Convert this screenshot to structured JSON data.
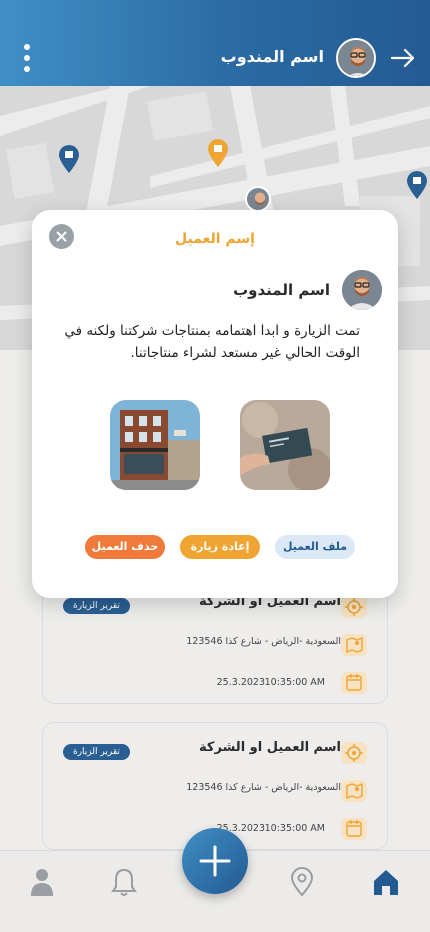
{
  "header": {
    "rep_name": "اسم المندوب",
    "menu_icon": "kebab-menu-icon",
    "back_icon": "arrow-right-icon"
  },
  "modal": {
    "title": "إسم العميل",
    "rep_name": "اسم المندوب",
    "note": "تمت الزيارة و ابدا اهتمامه بمنتاجات شركتنا ولكنه في الوقت الحالي غير مستعد لشراء منتاجاتنا.",
    "buttons": {
      "profile": "ملف العميل",
      "revisit": "إعادة زيارة",
      "delete": "حذف العميل"
    }
  },
  "visits": [
    {
      "title": "اسم العميل او الشركة",
      "report_label": "تقرير الزيارة",
      "address": "السعودية -الرياض - شارع كذا 123546",
      "time": "10:35:00 AM",
      "date": "25.3.2023"
    },
    {
      "title": "اسم العميل او الشركة",
      "report_label": "تقرير الزيارة",
      "address": "السعودية -الرياض - شارع كذا 123546",
      "time": "10:35:00 AM",
      "date": "25.3.2023"
    }
  ],
  "colors": {
    "primary": "#2b6aa4",
    "accent": "#f0a431",
    "danger": "#f07a3a",
    "light_blue": "#dbe9f7"
  },
  "nav": [
    "profile-icon",
    "bell-icon",
    "add-icon",
    "location-icon",
    "home-icon"
  ]
}
